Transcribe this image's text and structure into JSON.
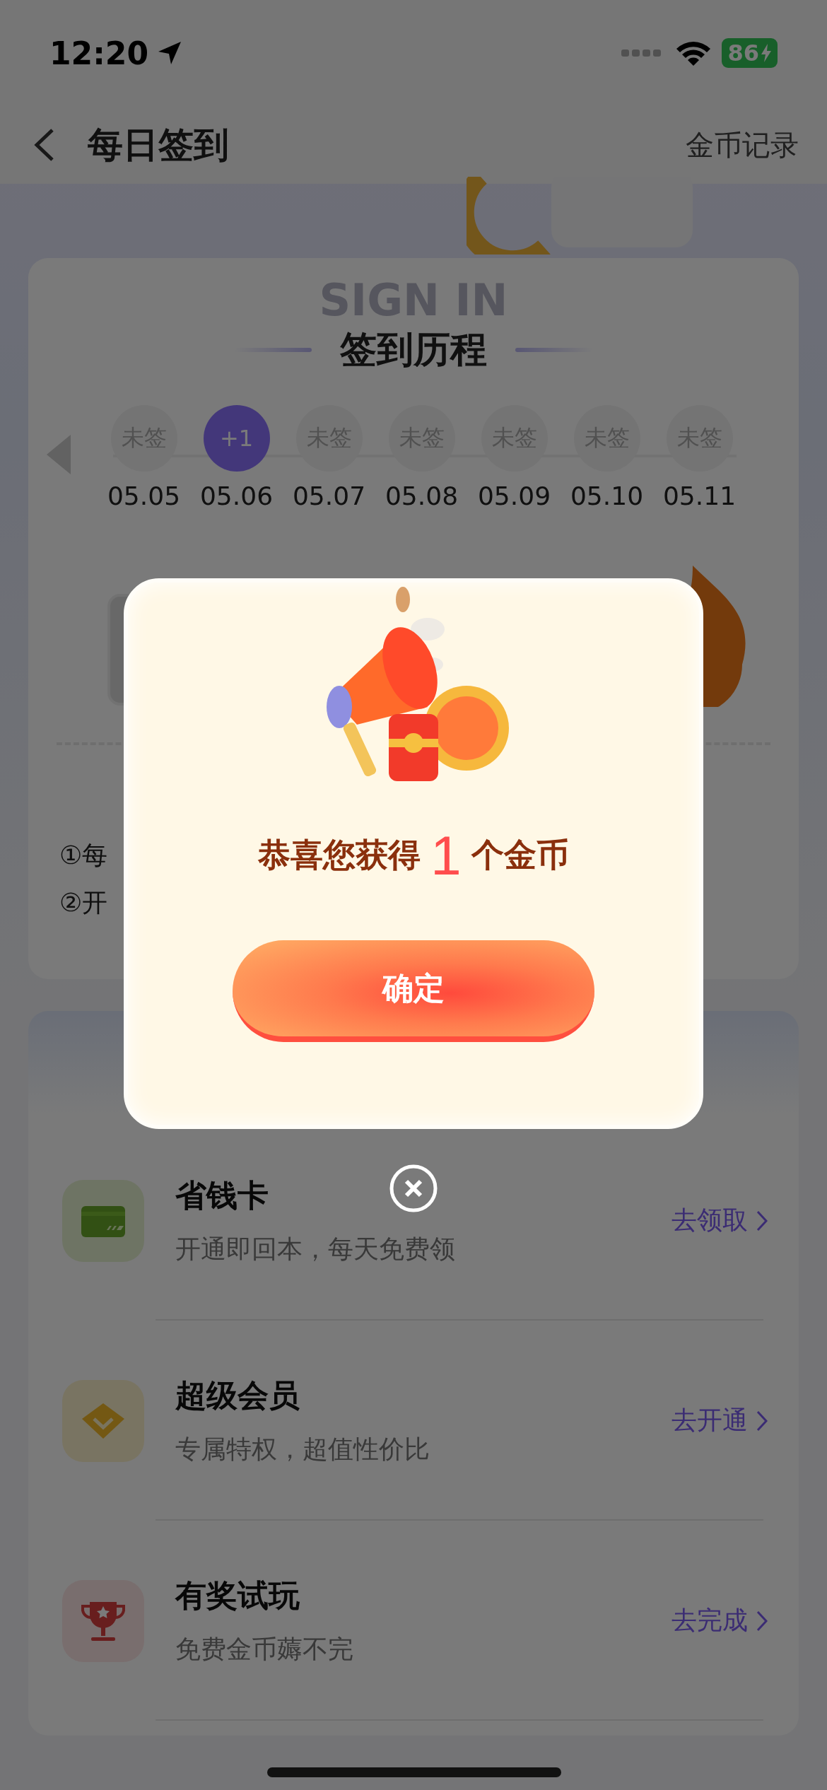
{
  "status_bar": {
    "time": "12:20",
    "battery": "86"
  },
  "nav": {
    "title": "每日签到",
    "action": "金币记录"
  },
  "history": {
    "watermark": "SIGN IN",
    "title": "签到历程",
    "days": [
      {
        "label": "未签",
        "date": "05.05",
        "selected": false
      },
      {
        "label": "+1",
        "date": "05.06",
        "selected": true
      },
      {
        "label": "未签",
        "date": "05.07",
        "selected": false
      },
      {
        "label": "未签",
        "date": "05.08",
        "selected": false
      },
      {
        "label": "未签",
        "date": "05.09",
        "selected": false
      },
      {
        "label": "未签",
        "date": "05.10",
        "selected": false
      },
      {
        "label": "未签",
        "date": "05.11",
        "selected": false
      }
    ],
    "rules": [
      "①每",
      "②开"
    ]
  },
  "tasks": [
    {
      "kind": "card",
      "title": "省钱卡",
      "subtitle": "开通即回本，每天免费领",
      "action": "去领取"
    },
    {
      "kind": "vip",
      "title": "超级会员",
      "subtitle": "专属特权，超值性价比",
      "action": "去开通"
    },
    {
      "kind": "trophy",
      "title": "有奖试玩",
      "subtitle": "免费金币薅不完",
      "action": "去完成"
    }
  ],
  "dialog": {
    "message_prefix": "恭喜您获得",
    "amount": "1",
    "message_suffix": "个金币",
    "confirm": "确定"
  }
}
